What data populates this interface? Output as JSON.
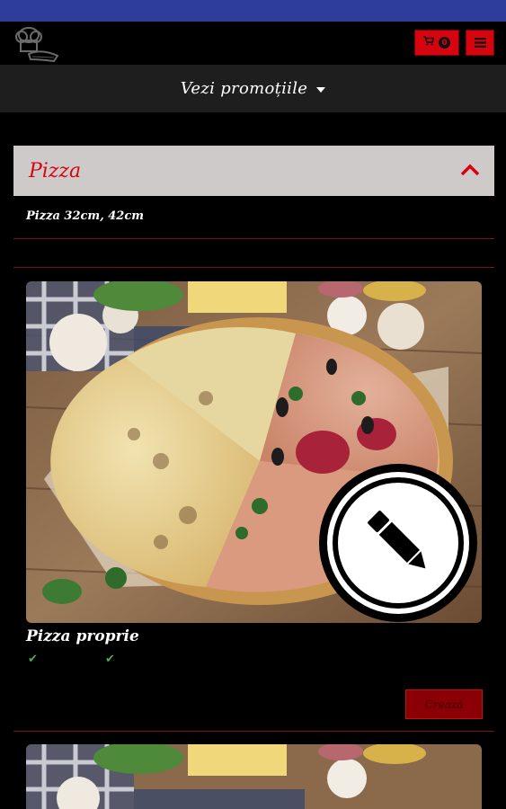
{
  "header": {
    "cart_icon": "cart-icon",
    "cart_count": "0",
    "menu_icon": "hamburger-menu-icon",
    "logo": "chef-hat-logo"
  },
  "promo": {
    "label": "Vezi promoțiile",
    "icon": "caret-down-icon"
  },
  "category": {
    "title": "Pizza",
    "subtitle": "Pizza 32cm, 42cm",
    "collapse_icon": "chevron-up-icon"
  },
  "products": [
    {
      "name": "Pizza proprie",
      "edit_icon": "pencil-icon",
      "features": [
        "check-icon",
        "check-icon"
      ],
      "create_label": "Crează"
    }
  ],
  "colors": {
    "accent": "#d6040e",
    "status_bar": "#2f3d9a",
    "category_bg": "#cfcaca",
    "divider": "#7a1212"
  }
}
